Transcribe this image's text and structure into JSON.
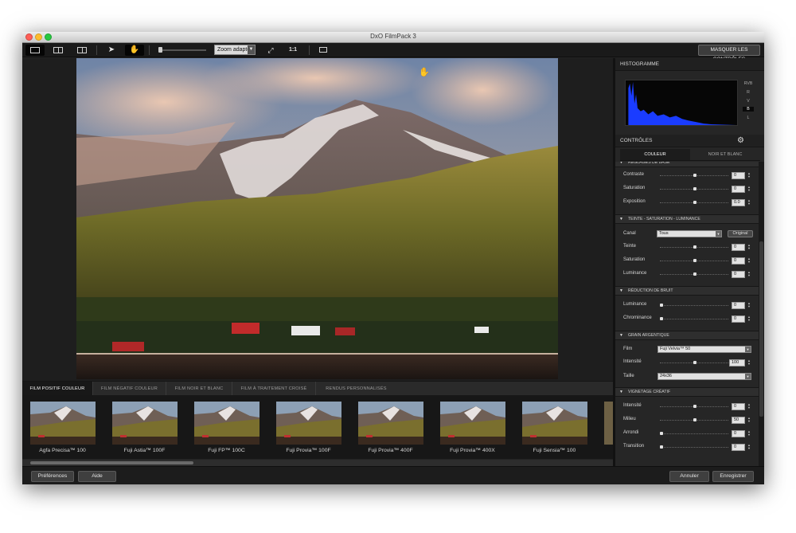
{
  "window": {
    "title": "DxO FilmPack 3"
  },
  "colors": {
    "accent_histogram": "#1a3cff",
    "selected_tab": "#181818",
    "panel": "#262626"
  },
  "toolbar": {
    "view_buttons": [
      "single-view-icon",
      "split-view-icon",
      "side-by-side-icon"
    ],
    "select_tool": "arrow-pointer-icon",
    "hand_tool": "hand-icon",
    "zoom_slider_value": 0,
    "zoom_select": "Zoom adapté",
    "fit_icon": "fullscreen-arrows-icon",
    "one_to_one": "1:1",
    "image_icon": "preview-frame-icon",
    "hide_controls": "MASQUER LES CONTRÔLES"
  },
  "film_tabs": [
    "FILM POSITIF COULEUR",
    "FILM NÉGATIF COULEUR",
    "FILM NOIR ET BLANC",
    "FILM À TRAITEMENT CROISÉ",
    "RENDUS PERSONNALISÉS"
  ],
  "thumbnails": [
    "Agfa Precisa™ 100",
    "Fuji Astia™ 100F",
    "Fuji FP™ 100C",
    "Fuji Provia™ 100F",
    "Fuji Provia™ 400F",
    "Fuji Provia™ 400X",
    "Fuji Sensia™ 100"
  ],
  "bottom": {
    "preferences": "Préférences",
    "help": "Aide",
    "cancel": "Annuler",
    "save": "Enregistrer"
  },
  "panel": {
    "histogram_title": "HISTOGRAMME",
    "channels": [
      "RVB",
      "R",
      "V",
      "B",
      "L"
    ],
    "selected_channel": "B",
    "controls_title": "CONTRÔLES",
    "tabs": [
      "COULEUR",
      "NOIR ET BLANC"
    ],
    "sections": {
      "base": {
        "title": "RÉGLAGES DE BASE",
        "rows": [
          {
            "label": "Contraste",
            "value": "0",
            "level": 0.5
          },
          {
            "label": "Saturation",
            "value": "0",
            "level": 0.5
          },
          {
            "label": "Exposition",
            "value": "0.0",
            "level": 0.5
          }
        ]
      },
      "hsl": {
        "title": "TEINTE - SATURATION - LUMINANCE",
        "canal_label": "Canal",
        "canal_value": "Tous",
        "original": "Original",
        "rows": [
          {
            "label": "Teinte",
            "value": "0",
            "level": 0.5
          },
          {
            "label": "Saturation",
            "value": "0",
            "level": 0.5
          },
          {
            "label": "Luminance",
            "value": "0",
            "level": 0.5
          }
        ]
      },
      "noise": {
        "title": "RÉDUCTION DE BRUIT",
        "rows": [
          {
            "label": "Luminance",
            "value": "0",
            "level": 0.0
          },
          {
            "label": "Chrominance",
            "value": "0",
            "level": 0.0
          }
        ]
      },
      "grain": {
        "title": "GRAIN ARGENTIQUE",
        "film_label": "Film",
        "film_value": "Fuji Velvia™ 50",
        "intensity_label": "Intensité",
        "intensity_value": "100",
        "intensity_level": 0.5,
        "size_label": "Taille",
        "size_value": "24x36"
      },
      "vignette": {
        "title": "VIGNETAGE CRÉATIF",
        "rows": [
          {
            "label": "Intensité",
            "value": "0",
            "level": 0.5
          },
          {
            "label": "Milieu",
            "value": "50",
            "level": 0.5
          },
          {
            "label": "Arrondi",
            "value": "0",
            "level": 0.0
          },
          {
            "label": "Transition",
            "value": "0",
            "level": 0.0
          }
        ]
      }
    }
  }
}
